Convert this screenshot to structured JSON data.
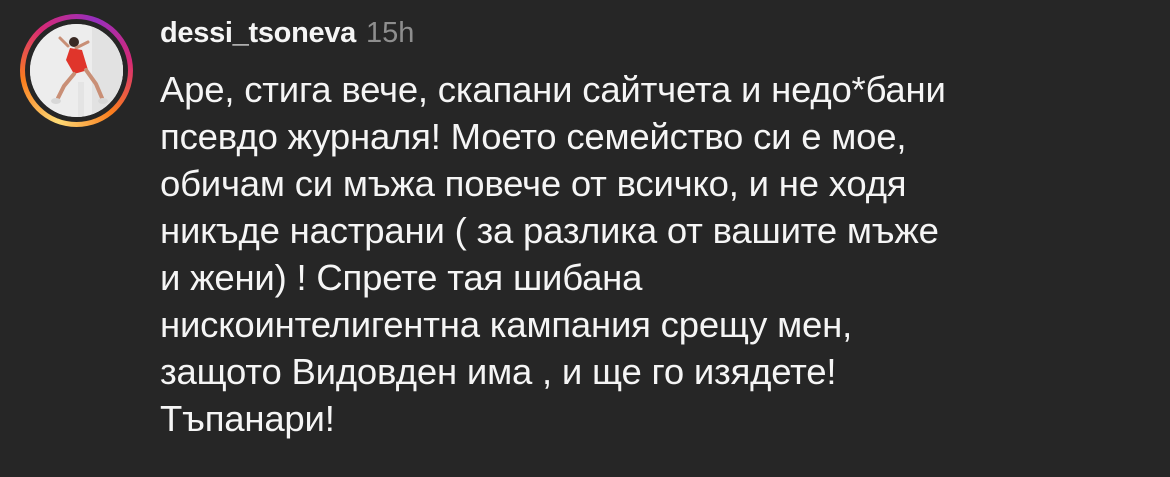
{
  "comment": {
    "username": "dessi_tsoneva",
    "timestamp": "15h",
    "text": "Аре, стига вече, скапани сайтчета и недо*бани\nпсевдо журналя! Моето семейство си е мое,\nобичам си мъжа повече от  всичко, и не ходя\nникъде настрани ( за разлика от вашите мъже\nи жени) ! Спрете тая шибана\nнискоинтелигентна кампания срещу мен,\nзащото Видовден има , и ще го изядете!\nТъпанари!",
    "avatar": {
      "icon": "user-avatar-photo",
      "ring_colors": [
        "#feda75",
        "#fa7e1e",
        "#d62976",
        "#962fbf"
      ]
    }
  },
  "theme": {
    "background": "#262626",
    "text_primary": "#f5f5f5",
    "text_secondary": "#8e8e8e"
  }
}
